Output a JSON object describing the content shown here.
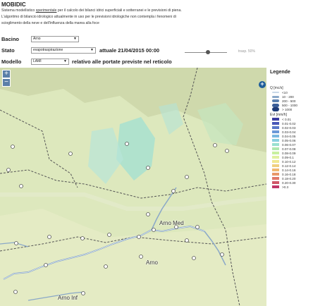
{
  "header": {
    "app_title": "MOBIDIC",
    "desc_1a": "Sistema modellistico ",
    "desc_1b": "sperimentale",
    "desc_1c": " per il calcolo dei bilanci idrici superficiali e sotterranei e le previsioni di piena.",
    "desc_2": "L'algoritmo di bilancio idrologico attualmente in uso per le previsioni idrologiche non contempla i fenomeni di",
    "desc_3": "scioglimento della neve e dell'influenza della marea alla foce"
  },
  "controls": {
    "bacino_label": "Bacino",
    "bacino_value": "Arno",
    "stato_label": "Stato",
    "stato_value": "evapotraspirazione",
    "stato_date": "attuale 21/04/2015 00:00",
    "trasp_label": "trasp. 50%",
    "transparency_fraction": 0.5,
    "modello_label": "Modello",
    "modello_value": "LAMI",
    "modello_text": "relativo alle portate previste nel reticolo"
  },
  "map": {
    "zoom_in": "+",
    "zoom_out": "−",
    "labels": {
      "arno_med": "Arno Med",
      "arno": "Arno",
      "arno_inf": "Arno Inf"
    }
  },
  "legend": {
    "title": "Legende",
    "flow_title": "Q [mc/s]",
    "flow_items": [
      {
        "label": "<10",
        "color": "#c8d8e8"
      },
      {
        "label": "10 - 200",
        "color": "#8aa8c8"
      },
      {
        "label": "200 - 500",
        "color": "#5a80b0"
      },
      {
        "label": "500 - 1000",
        "color": "#3a5e98"
      },
      {
        "label": "> 1000",
        "color": "#1e3c78"
      }
    ],
    "evt_title": "Evt [mm/h]",
    "evt_items": [
      {
        "label": "< 0.01",
        "color": "#3a3aa0"
      },
      {
        "label": "0.01-0.02",
        "color": "#4a58b8"
      },
      {
        "label": "0.02-0.03",
        "color": "#5a78c8"
      },
      {
        "label": "0.03-0.04",
        "color": "#6a98d8"
      },
      {
        "label": "0.04-0.05",
        "color": "#7ab8e0"
      },
      {
        "label": "0.05-0.06",
        "color": "#8ad0e0"
      },
      {
        "label": "0.06-0.07",
        "color": "#9ae0d0"
      },
      {
        "label": "0.07-0.08",
        "color": "#b0e8b0"
      },
      {
        "label": "0.08-0.09",
        "color": "#c8f0a0"
      },
      {
        "label": "0.09-0.1",
        "color": "#e0f0a0"
      },
      {
        "label": "0.10-0.12",
        "color": "#f0e890"
      },
      {
        "label": "0.12-0.14",
        "color": "#f0d080"
      },
      {
        "label": "0.14-0.16",
        "color": "#f0b870"
      },
      {
        "label": "0.16-0.18",
        "color": "#e89868"
      },
      {
        "label": "0.18-0.20",
        "color": "#e07868"
      },
      {
        "label": "0.20-0.30",
        "color": "#d05868"
      },
      {
        "label": ">0.3",
        "color": "#c03868"
      }
    ]
  }
}
